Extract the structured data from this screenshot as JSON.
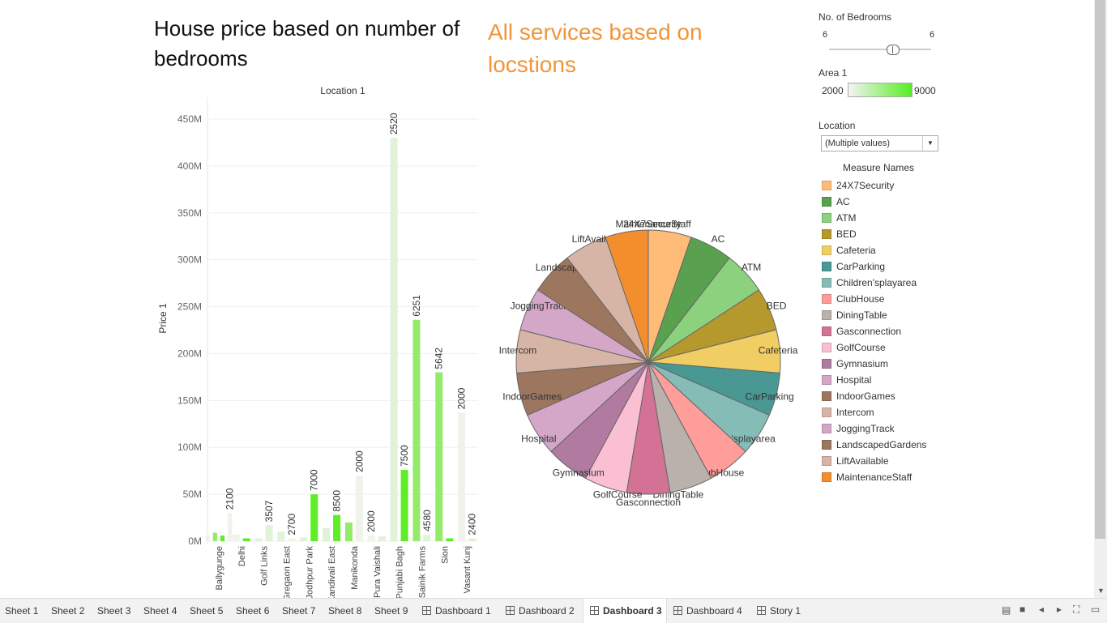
{
  "titles": {
    "left": "House price based on number of bedrooms",
    "right": "All services based on locstions"
  },
  "filters": {
    "bedrooms": {
      "label": "No. of Bedrooms",
      "min": "6",
      "max": "6"
    },
    "area": {
      "label": "Area 1",
      "min": "2000",
      "max": "9000"
    },
    "location": {
      "label": "Location",
      "value": "(Multiple values)"
    },
    "legend_title": "Measure Names"
  },
  "colors": {
    "bar_light": "#eff3ec",
    "bar_mid": "#95ea6a",
    "bar_bright": "#5fed25",
    "bar_pale_green": "#e0f2d7",
    "pie_border": "#666666"
  },
  "chart_data": [
    {
      "type": "bar",
      "title": "Location 1",
      "ylabel": "Price 1",
      "xlabel": "",
      "ylim": [
        0,
        470000000
      ],
      "grid": true,
      "yticks": [
        {
          "value": 0,
          "label": "0M"
        },
        {
          "value": 50000000,
          "label": "50M"
        },
        {
          "value": 100000000,
          "label": "100M"
        },
        {
          "value": 150000000,
          "label": "150M"
        },
        {
          "value": 200000000,
          "label": "200M"
        },
        {
          "value": 250000000,
          "label": "250M"
        },
        {
          "value": 300000000,
          "label": "300M"
        },
        {
          "value": 350000000,
          "label": "350M"
        },
        {
          "value": 400000000,
          "label": "400M"
        },
        {
          "value": 450000000,
          "label": "450M"
        }
      ],
      "categories": [
        "Ballygunge",
        "Delhi",
        "Golf Links",
        "Gregaon East",
        "Jodhpur Park",
        "Kandivali East",
        "Manikonda",
        "Pura Vaishali",
        "Punjabi Bagh",
        "Sainik Farms",
        "Sion",
        "Vasant Kunj"
      ],
      "bars": [
        {
          "category": 0,
          "value": 6000000,
          "color": "#eff3ec",
          "label": ""
        },
        {
          "category": 0,
          "value": 9000000,
          "color": "#95ea6a",
          "label": ""
        },
        {
          "category": 0,
          "value": 6000000,
          "color": "#5fed25",
          "label": ""
        },
        {
          "category": 0,
          "value": 30000000,
          "color": "#eff3ec",
          "label": "2100"
        },
        {
          "category": 1,
          "value": 7000000,
          "color": "#eff3ec",
          "label": ""
        },
        {
          "category": 1,
          "value": 3000000,
          "color": "#5fed25",
          "label": ""
        },
        {
          "category": 2,
          "value": 3000000,
          "color": "#e0f2d7",
          "label": ""
        },
        {
          "category": 2,
          "value": 17000000,
          "color": "#e0f2d7",
          "label": "3507"
        },
        {
          "category": 3,
          "value": 10000000,
          "color": "#e0f2d7",
          "label": ""
        },
        {
          "category": 3,
          "value": 3000000,
          "color": "#eff3ec",
          "label": "2700"
        },
        {
          "category": 4,
          "value": 4000000,
          "color": "#e0f2d7",
          "label": ""
        },
        {
          "category": 4,
          "value": 50000000,
          "color": "#5fed25",
          "label": "7000"
        },
        {
          "category": 5,
          "value": 14000000,
          "color": "#e0f2d7",
          "label": ""
        },
        {
          "category": 5,
          "value": 28000000,
          "color": "#5fed25",
          "label": "8500"
        },
        {
          "category": 6,
          "value": 20000000,
          "color": "#95ea6a",
          "label": ""
        },
        {
          "category": 6,
          "value": 70000000,
          "color": "#eff3ec",
          "label": "2000"
        },
        {
          "category": 7,
          "value": 6000000,
          "color": "#eff3ec",
          "label": "2000"
        },
        {
          "category": 7,
          "value": 5000000,
          "color": "#e0f2d7",
          "label": ""
        },
        {
          "category": 8,
          "value": 430000000,
          "color": "#e0f2d7",
          "label": "2520"
        },
        {
          "category": 8,
          "value": 76000000,
          "color": "#5fed25",
          "label": "7500"
        },
        {
          "category": 9,
          "value": 236000000,
          "color": "#95ea6a",
          "label": "6251"
        },
        {
          "category": 9,
          "value": 7000000,
          "color": "#e0f2d7",
          "label": "4580"
        },
        {
          "category": 10,
          "value": 180000000,
          "color": "#95ea6a",
          "label": "5642"
        },
        {
          "category": 10,
          "value": 3000000,
          "color": "#5fed25",
          "label": ""
        },
        {
          "category": 11,
          "value": 137000000,
          "color": "#eff3ec",
          "label": "2000"
        },
        {
          "category": 11,
          "value": 3000000,
          "color": "#e0f2d7",
          "label": "2400"
        }
      ]
    },
    {
      "type": "pie",
      "slices": [
        {
          "name": "24X7Security",
          "value": 1,
          "color": "#ffbb78"
        },
        {
          "name": "AC",
          "value": 1,
          "color": "#59a14f"
        },
        {
          "name": "ATM",
          "value": 1,
          "color": "#8cd17d"
        },
        {
          "name": "BED",
          "value": 1,
          "color": "#b6992d"
        },
        {
          "name": "Cafeteria",
          "value": 1,
          "color": "#f1ce63"
        },
        {
          "name": "CarParking",
          "value": 1,
          "color": "#499894"
        },
        {
          "name": "Children'splayarea",
          "value": 1,
          "color": "#86bcb6"
        },
        {
          "name": "ClubHouse",
          "value": 1,
          "color": "#ff9d9a"
        },
        {
          "name": "DiningTable",
          "value": 1,
          "color": "#bab0ac"
        },
        {
          "name": "Gasconnection",
          "value": 1,
          "color": "#d37295"
        },
        {
          "name": "GolfCourse",
          "value": 1,
          "color": "#fabfd2"
        },
        {
          "name": "Gymnasium",
          "value": 1,
          "color": "#b07aa1"
        },
        {
          "name": "Hospital",
          "value": 1,
          "color": "#d4a6c8"
        },
        {
          "name": "IndoorGames",
          "value": 1,
          "color": "#9d7660"
        },
        {
          "name": "Intercom",
          "value": 1,
          "color": "#d7b5a6"
        },
        {
          "name": "JoggingTrack",
          "value": 1,
          "color": "#d4a6c8"
        },
        {
          "name": "LandscapedGardens",
          "value": 1,
          "color": "#9d7660"
        },
        {
          "name": "LiftAvailable",
          "value": 1,
          "color": "#d7b5a6"
        },
        {
          "name": "MaintenanceStaff",
          "value": 1,
          "color": "#f28e2b"
        }
      ],
      "legend": "right"
    }
  ],
  "tabs": [
    {
      "label": "Sheet 1",
      "kind": "sheet"
    },
    {
      "label": "Sheet 2",
      "kind": "sheet"
    },
    {
      "label": "Sheet 3",
      "kind": "sheet"
    },
    {
      "label": "Sheet 4",
      "kind": "sheet"
    },
    {
      "label": "Sheet 5",
      "kind": "sheet"
    },
    {
      "label": "Sheet 6",
      "kind": "sheet"
    },
    {
      "label": "Sheet 7",
      "kind": "sheet"
    },
    {
      "label": "Sheet 8",
      "kind": "sheet"
    },
    {
      "label": "Sheet 9",
      "kind": "sheet"
    },
    {
      "label": "Dashboard 1",
      "kind": "dashboard"
    },
    {
      "label": "Dashboard 2",
      "kind": "dashboard"
    },
    {
      "label": "Dashboard 3",
      "kind": "dashboard",
      "active": true
    },
    {
      "label": "Dashboard 4",
      "kind": "dashboard"
    },
    {
      "label": "Story 1",
      "kind": "story"
    }
  ]
}
